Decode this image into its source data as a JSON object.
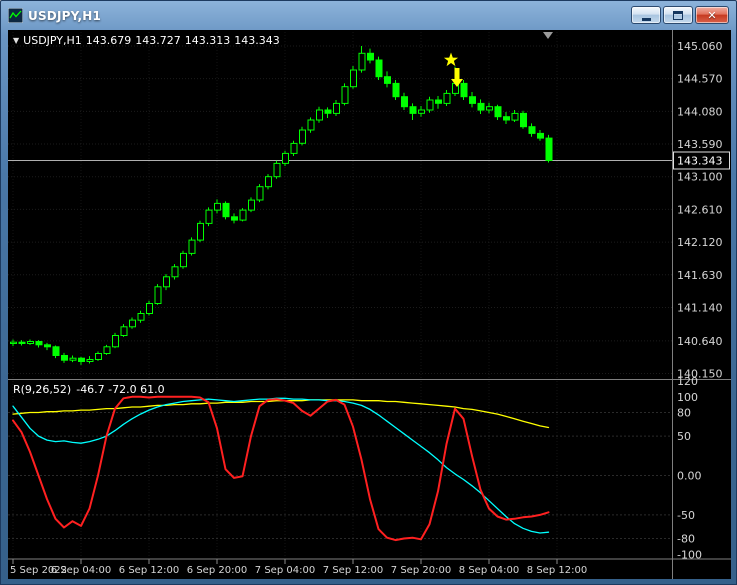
{
  "window": {
    "title": "USDJPY,H1"
  },
  "icons": {
    "close_glyph": "✕",
    "collapse_triangle": "▼"
  },
  "ohlc": {
    "symbol": "USDJPY,H1",
    "open": "143.679",
    "high": "143.727",
    "low": "143.313",
    "close": "143.343"
  },
  "colors": {
    "bull_candle": "#00ff00",
    "bear_candle": "#00ff00",
    "background": "#000000",
    "indicator_main": "#ff2020",
    "indicator_signal": "#00ffff",
    "indicator_slow": "#ffff00",
    "annotation": "#ffff00"
  },
  "chart_data": {
    "type": "candlestick",
    "symbol": "USDJPY",
    "timeframe": "H1",
    "price_axis": {
      "ticks": [
        "145.060",
        "144.570",
        "144.080",
        "143.590",
        "143.100",
        "142.610",
        "142.120",
        "141.630",
        "141.140",
        "140.640",
        "140.150"
      ],
      "current": "143.343"
    },
    "time_labels": [
      {
        "index": 0,
        "label": "5 Sep 2022"
      },
      {
        "index": 8,
        "label": "6 Sep 04:00"
      },
      {
        "index": 16,
        "label": "6 Sep 12:00"
      },
      {
        "index": 24,
        "label": "6 Sep 20:00"
      },
      {
        "index": 32,
        "label": "7 Sep 04:00"
      },
      {
        "index": 40,
        "label": "7 Sep 12:00"
      },
      {
        "index": 48,
        "label": "7 Sep 20:00"
      },
      {
        "index": 56,
        "label": "8 Sep 04:00"
      },
      {
        "index": 64,
        "label": "8 Sep 12:00"
      }
    ],
    "candles": [
      [
        140.6,
        140.66,
        140.56,
        140.62
      ],
      [
        140.62,
        140.65,
        140.57,
        140.6
      ],
      [
        140.6,
        140.66,
        140.58,
        140.63
      ],
      [
        140.63,
        140.65,
        140.54,
        140.58
      ],
      [
        140.58,
        140.61,
        140.5,
        140.55
      ],
      [
        140.55,
        140.57,
        140.38,
        140.42
      ],
      [
        140.42,
        140.46,
        140.31,
        140.35
      ],
      [
        140.35,
        140.42,
        140.32,
        140.38
      ],
      [
        140.38,
        140.4,
        140.28,
        140.33
      ],
      [
        140.33,
        140.41,
        140.3,
        140.36
      ],
      [
        140.36,
        140.48,
        140.34,
        140.45
      ],
      [
        140.45,
        140.58,
        140.43,
        140.55
      ],
      [
        140.55,
        140.76,
        140.53,
        140.72
      ],
      [
        140.72,
        140.89,
        140.7,
        140.85
      ],
      [
        140.85,
        140.99,
        140.82,
        140.95
      ],
      [
        140.95,
        141.09,
        140.91,
        141.05
      ],
      [
        141.05,
        141.24,
        141.02,
        141.2
      ],
      [
        141.2,
        141.49,
        141.18,
        141.45
      ],
      [
        141.45,
        141.64,
        141.4,
        141.6
      ],
      [
        141.6,
        141.79,
        141.56,
        141.75
      ],
      [
        141.75,
        141.99,
        141.72,
        141.95
      ],
      [
        141.95,
        142.19,
        141.92,
        142.15
      ],
      [
        142.15,
        142.44,
        142.12,
        142.4
      ],
      [
        142.4,
        142.64,
        142.36,
        142.6
      ],
      [
        142.6,
        142.76,
        142.55,
        142.7
      ],
      [
        142.7,
        142.73,
        142.46,
        142.5
      ],
      [
        142.5,
        142.55,
        142.4,
        142.45
      ],
      [
        142.45,
        142.63,
        142.43,
        142.6
      ],
      [
        142.6,
        142.79,
        142.57,
        142.75
      ],
      [
        142.75,
        142.99,
        142.72,
        142.95
      ],
      [
        142.95,
        143.14,
        142.91,
        143.1
      ],
      [
        143.1,
        143.34,
        143.07,
        143.3
      ],
      [
        143.3,
        143.49,
        143.26,
        143.45
      ],
      [
        143.45,
        143.64,
        143.41,
        143.6
      ],
      [
        143.6,
        143.85,
        143.57,
        143.8
      ],
      [
        143.8,
        143.99,
        143.76,
        143.95
      ],
      [
        143.95,
        144.15,
        143.91,
        144.1
      ],
      [
        144.1,
        144.14,
        143.98,
        144.05
      ],
      [
        144.05,
        144.25,
        144.01,
        144.2
      ],
      [
        144.2,
        144.5,
        144.17,
        144.45
      ],
      [
        144.45,
        144.76,
        144.42,
        144.7
      ],
      [
        144.7,
        145.06,
        144.66,
        144.95
      ],
      [
        144.95,
        145.02,
        144.8,
        144.85
      ],
      [
        144.85,
        144.9,
        144.55,
        144.6
      ],
      [
        144.6,
        144.68,
        144.44,
        144.5
      ],
      [
        144.5,
        144.55,
        144.25,
        144.3
      ],
      [
        144.3,
        144.36,
        144.1,
        144.15
      ],
      [
        144.15,
        144.2,
        143.95,
        144.05
      ],
      [
        144.05,
        144.16,
        144.0,
        144.1
      ],
      [
        144.1,
        144.3,
        144.06,
        144.25
      ],
      [
        144.25,
        144.31,
        144.12,
        144.2
      ],
      [
        144.2,
        144.4,
        144.16,
        144.35
      ],
      [
        144.35,
        144.75,
        144.31,
        144.5
      ],
      [
        144.5,
        144.55,
        144.25,
        144.3
      ],
      [
        144.3,
        144.37,
        144.14,
        144.2
      ],
      [
        144.2,
        144.26,
        144.04,
        144.1
      ],
      [
        144.1,
        144.21,
        144.05,
        144.15
      ],
      [
        144.15,
        144.18,
        143.95,
        144.0
      ],
      [
        144.0,
        144.07,
        143.89,
        143.95
      ],
      [
        143.95,
        144.1,
        143.92,
        144.05
      ],
      [
        144.05,
        144.09,
        143.82,
        143.85
      ],
      [
        143.85,
        143.9,
        143.7,
        143.75
      ],
      [
        143.75,
        143.8,
        143.64,
        143.68
      ],
      [
        143.679,
        143.727,
        143.313,
        143.343
      ]
    ],
    "indicator": {
      "label": "R(9,26,52)",
      "values_text": "-46.7 -72.0 61.0",
      "axis": {
        "ticks": [
          "120",
          "100",
          "80",
          "50",
          "0.00",
          "-50",
          "-80",
          "-100"
        ],
        "range": [
          -106,
          120
        ]
      },
      "levels": [
        80,
        50,
        0,
        -50,
        -80
      ],
      "series": [
        {
          "name": "slow",
          "color": "#ffff00",
          "width": 1.3,
          "values": [
            78,
            79,
            80,
            80,
            81,
            81,
            82,
            82,
            83,
            83,
            84,
            85,
            85,
            86,
            87,
            87,
            88,
            89,
            89,
            90,
            90,
            91,
            91,
            92,
            92,
            93,
            93,
            93,
            94,
            94,
            94,
            95,
            95,
            95,
            95,
            96,
            96,
            96,
            96,
            96,
            96,
            95,
            95,
            95,
            94,
            94,
            93,
            92,
            91,
            90,
            89,
            88,
            87,
            85,
            84,
            82,
            80,
            78,
            75,
            72,
            69,
            66,
            63,
            61
          ]
        },
        {
          "name": "signal",
          "color": "#00ffff",
          "width": 1.3,
          "values": [
            88,
            74,
            60,
            50,
            45,
            43,
            44,
            42,
            41,
            43,
            46,
            50,
            57,
            65,
            72,
            78,
            83,
            87,
            90,
            92,
            94,
            95,
            96,
            97,
            96,
            95,
            94,
            95,
            96,
            97,
            97,
            98,
            98,
            97,
            97,
            96,
            96,
            95,
            95,
            94,
            92,
            89,
            84,
            77,
            69,
            61,
            53,
            45,
            37,
            29,
            20,
            10,
            2,
            -5,
            -13,
            -22,
            -32,
            -42,
            -52,
            -61,
            -67,
            -71,
            -73,
            -72
          ]
        },
        {
          "name": "main",
          "color": "#ff2020",
          "width": 2,
          "values": [
            70,
            55,
            30,
            0,
            -30,
            -55,
            -66,
            -58,
            -64,
            -42,
            0,
            50,
            85,
            98,
            100,
            100,
            99,
            100,
            100,
            100,
            100,
            100,
            99,
            93,
            60,
            8,
            -3,
            -1,
            50,
            88,
            96,
            97,
            95,
            92,
            82,
            76,
            85,
            94,
            96,
            90,
            62,
            20,
            -30,
            -68,
            -79,
            -82,
            -80,
            -79,
            -81,
            -62,
            -20,
            40,
            85,
            72,
            25,
            -18,
            -42,
            -52,
            -56,
            -55,
            -53,
            -52,
            -50,
            -46.7
          ]
        }
      ]
    },
    "objects": [
      {
        "type": "star",
        "candle_index": 52,
        "dx": -4,
        "price": 144.85,
        "color": "#ffff00"
      },
      {
        "type": "arrow-down",
        "candle_index": 52,
        "dx": 2,
        "price": 144.73,
        "color": "#ffff00"
      }
    ]
  }
}
